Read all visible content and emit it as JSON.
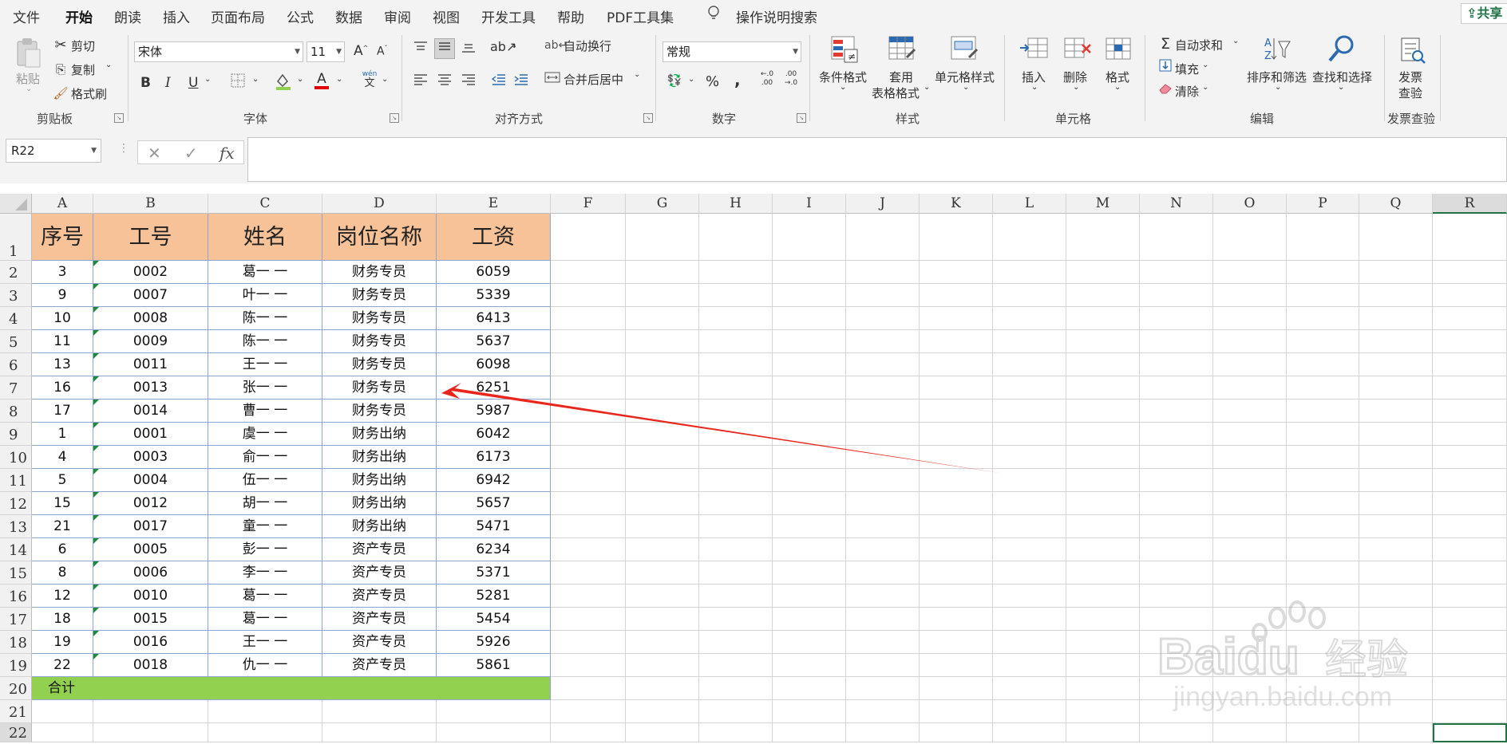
{
  "menu": {
    "tabs": [
      "文件",
      "开始",
      "朗读",
      "插入",
      "页面布局",
      "公式",
      "数据",
      "审阅",
      "视图",
      "开发工具",
      "帮助",
      "PDF工具集"
    ],
    "active": "开始",
    "search": "操作说明搜索",
    "share": "共享"
  },
  "ribbon": {
    "clipboard": {
      "paste": "粘贴",
      "cut": "剪切",
      "copy": "复制",
      "format_painter": "格式刷",
      "label": "剪贴板"
    },
    "font": {
      "name": "宋体",
      "size": "11",
      "label": "字体",
      "bold": "B",
      "italic": "I",
      "underline": "U",
      "grow": "A",
      "shrink": "A",
      "font_color": "A",
      "pinyin": "wén"
    },
    "alignment": {
      "wrap": "自动换行",
      "merge": "合并后居中",
      "label": "对齐方式"
    },
    "number": {
      "format": "常规",
      "percent": "%",
      "comma": ",",
      "inc_decimal": ".0",
      "dec_decimal": ".00",
      "label": "数字"
    },
    "styles": {
      "conditional": "条件格式",
      "table_line1": "套用",
      "table_line2": "表格格式",
      "cell_styles": "单元格样式",
      "label": "样式"
    },
    "cells": {
      "insert": "插入",
      "delete": "删除",
      "format": "格式",
      "label": "单元格"
    },
    "editing": {
      "autosum": "自动求和",
      "fill": "填充",
      "clear": "清除",
      "sort": "排序和筛选",
      "find": "查找和选择",
      "label": "编辑"
    },
    "invoice": {
      "line1": "发票",
      "line2": "查验",
      "label": "发票查验"
    }
  },
  "formula_bar": {
    "name_box": "R22",
    "cancel": "✕",
    "enter": "✓",
    "fx": "fx",
    "content": ""
  },
  "columns": [
    "A",
    "B",
    "C",
    "D",
    "E",
    "F",
    "G",
    "H",
    "I",
    "J",
    "K",
    "L",
    "M",
    "N",
    "O",
    "P",
    "Q",
    "R"
  ],
  "selected_column": "R",
  "selected_row": "22",
  "row_numbers": [
    "1",
    "2",
    "3",
    "4",
    "5",
    "6",
    "7",
    "8",
    "9",
    "10",
    "11",
    "12",
    "13",
    "14",
    "15",
    "16",
    "17",
    "18",
    "19",
    "20",
    "21",
    "22"
  ],
  "table": {
    "headers": [
      "序号",
      "工号",
      "姓名",
      "岗位名称",
      "工资"
    ],
    "rows": [
      [
        "3",
        "0002",
        "葛一 一",
        "财务专员",
        "6059"
      ],
      [
        "9",
        "0007",
        "叶一 一",
        "财务专员",
        "5339"
      ],
      [
        "10",
        "0008",
        "陈一 一",
        "财务专员",
        "6413"
      ],
      [
        "11",
        "0009",
        "陈一 一",
        "财务专员",
        "5637"
      ],
      [
        "13",
        "0011",
        "王一 一",
        "财务专员",
        "6098"
      ],
      [
        "16",
        "0013",
        "张一 一",
        "财务专员",
        "6251"
      ],
      [
        "17",
        "0014",
        "曹一 一",
        "财务专员",
        "5987"
      ],
      [
        "1",
        "0001",
        "虞一 一",
        "财务出纳",
        "6042"
      ],
      [
        "4",
        "0003",
        "俞一 一",
        "财务出纳",
        "6173"
      ],
      [
        "5",
        "0004",
        "伍一 一",
        "财务出纳",
        "6942"
      ],
      [
        "15",
        "0012",
        "胡一 一",
        "财务出纳",
        "5657"
      ],
      [
        "21",
        "0017",
        "童一 一",
        "财务出纳",
        "5471"
      ],
      [
        "6",
        "0005",
        "彭一 一",
        "资产专员",
        "6234"
      ],
      [
        "8",
        "0006",
        "李一 一",
        "资产专员",
        "5371"
      ],
      [
        "12",
        "0010",
        "葛一 一",
        "资产专员",
        "5281"
      ],
      [
        "18",
        "0015",
        "葛一 一",
        "资产专员",
        "5454"
      ],
      [
        "19",
        "0016",
        "王一 一",
        "资产专员",
        "5926"
      ],
      [
        "22",
        "0018",
        "仇一 一",
        "资产专员",
        "5861"
      ]
    ],
    "total_label": "合计"
  },
  "watermark": {
    "brand": "Baidu",
    "brand_cn": "经验",
    "url": "jingyan.baidu.com"
  },
  "colors": {
    "accent": "#217346",
    "header_fill": "#f8c299",
    "total_fill": "#92d050",
    "arrow": "#e8261c"
  }
}
